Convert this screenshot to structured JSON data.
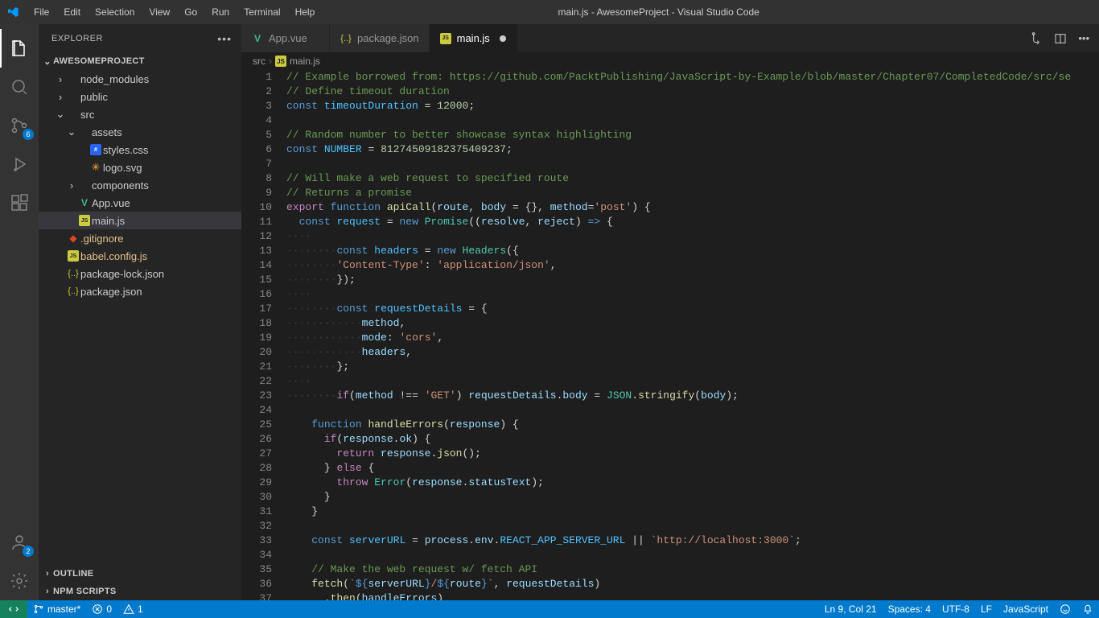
{
  "window": {
    "title": "main.js - AwesomeProject - Visual Studio Code"
  },
  "menu": [
    "File",
    "Edit",
    "Selection",
    "View",
    "Go",
    "Run",
    "Terminal",
    "Help"
  ],
  "activity": {
    "scm_badge": "6",
    "accounts_badge": "2"
  },
  "explorer": {
    "title": "EXPLORER",
    "project": "AWESOMEPROJECT",
    "tree": [
      {
        "depth": 1,
        "tw": "›",
        "icon": "folder",
        "label": "node_modules",
        "interact": true
      },
      {
        "depth": 1,
        "tw": "›",
        "icon": "folder",
        "label": "public",
        "interact": true
      },
      {
        "depth": 1,
        "tw": "⌄",
        "icon": "folder",
        "label": "src",
        "interact": true
      },
      {
        "depth": 2,
        "tw": "⌄",
        "icon": "folder",
        "label": "assets",
        "interact": true
      },
      {
        "depth": 3,
        "tw": "",
        "icon": "css",
        "label": "styles.css",
        "interact": true
      },
      {
        "depth": 3,
        "tw": "",
        "icon": "svg",
        "label": "logo.svg",
        "interact": true
      },
      {
        "depth": 2,
        "tw": "›",
        "icon": "folder",
        "label": "components",
        "interact": true
      },
      {
        "depth": 2,
        "tw": "",
        "icon": "vue",
        "label": "App.vue",
        "interact": true
      },
      {
        "depth": 2,
        "tw": "",
        "icon": "js",
        "label": "main.js",
        "interact": true,
        "sel": true
      },
      {
        "depth": 1,
        "tw": "",
        "icon": "git",
        "label": ".gitignore",
        "interact": true,
        "mod": true
      },
      {
        "depth": 1,
        "tw": "",
        "icon": "js",
        "label": "babel.config.js",
        "interact": true,
        "mod": true
      },
      {
        "depth": 1,
        "tw": "",
        "icon": "json",
        "label": "package-lock.json",
        "interact": true
      },
      {
        "depth": 1,
        "tw": "",
        "icon": "json",
        "label": "package.json",
        "interact": true
      }
    ],
    "outline": "OUTLINE",
    "npm": "NPM SCRIPTS"
  },
  "tabs": [
    {
      "icon": "vue",
      "label": "App.vue",
      "active": false,
      "dirty": false
    },
    {
      "icon": "json",
      "label": "package.json",
      "active": false,
      "dirty": false
    },
    {
      "icon": "js",
      "label": "main.js",
      "active": true,
      "dirty": true
    }
  ],
  "breadcrumb": {
    "a": "src",
    "b": "main.js"
  },
  "status": {
    "branch": "master*",
    "errors": "0",
    "warnings": "1",
    "cursor": "Ln 9, Col 21",
    "spaces": "Spaces: 4",
    "encoding": "UTF-8",
    "eol": "LF",
    "lang": "JavaScript"
  },
  "code": {
    "lines": 37
  }
}
